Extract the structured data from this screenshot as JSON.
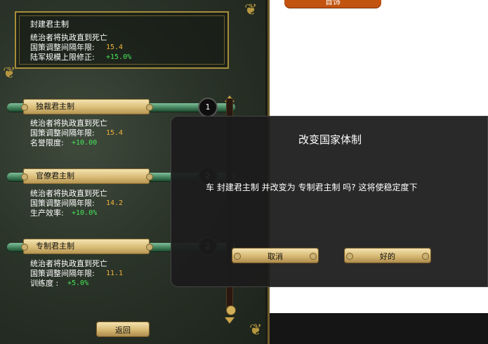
{
  "current_government": {
    "name": "封建君主制",
    "line1": "统治者将执政直到死亡",
    "line2_label": "国策调整间隔年限:",
    "line2_value": "15.4",
    "line3_label": "陆军规模上限修正:",
    "line3_value": "+15.0%"
  },
  "options": [
    {
      "name": "独裁君主制",
      "index": "1",
      "line1": "统治者将执政直到死亡",
      "line2_label": "国策调整间隔年限:",
      "line2_value": "15.4",
      "line3_label": "名誉限度:",
      "line3_value": "+10.00"
    },
    {
      "name": "官僚君主制",
      "index": "2",
      "line1": "统治者将执政直到死亡",
      "line2_label": "国策调整间隔年限:",
      "line2_value": "14.2",
      "line3_label": "生产效率:",
      "line3_value": "+10.0%"
    },
    {
      "name": "专制君主制",
      "index": "2",
      "line1": "统治者将执政直到死亡",
      "line2_label": "国策调整间隔年限:",
      "line2_value": "11.1",
      "line3_label": "训练度 :",
      "line3_value": "+5.0%"
    }
  ],
  "back_button": "返回",
  "top_button": "首饰",
  "dialog": {
    "title": "改变国家体制",
    "message": "车 封建君主制 并改变为 专制君主制 吗? 这将使稳定度下",
    "cancel": "取消",
    "ok": "好的"
  },
  "colors": {
    "value_orange": "#f0b23c",
    "value_green": "#46e45a",
    "top_button": "#c2540f"
  }
}
